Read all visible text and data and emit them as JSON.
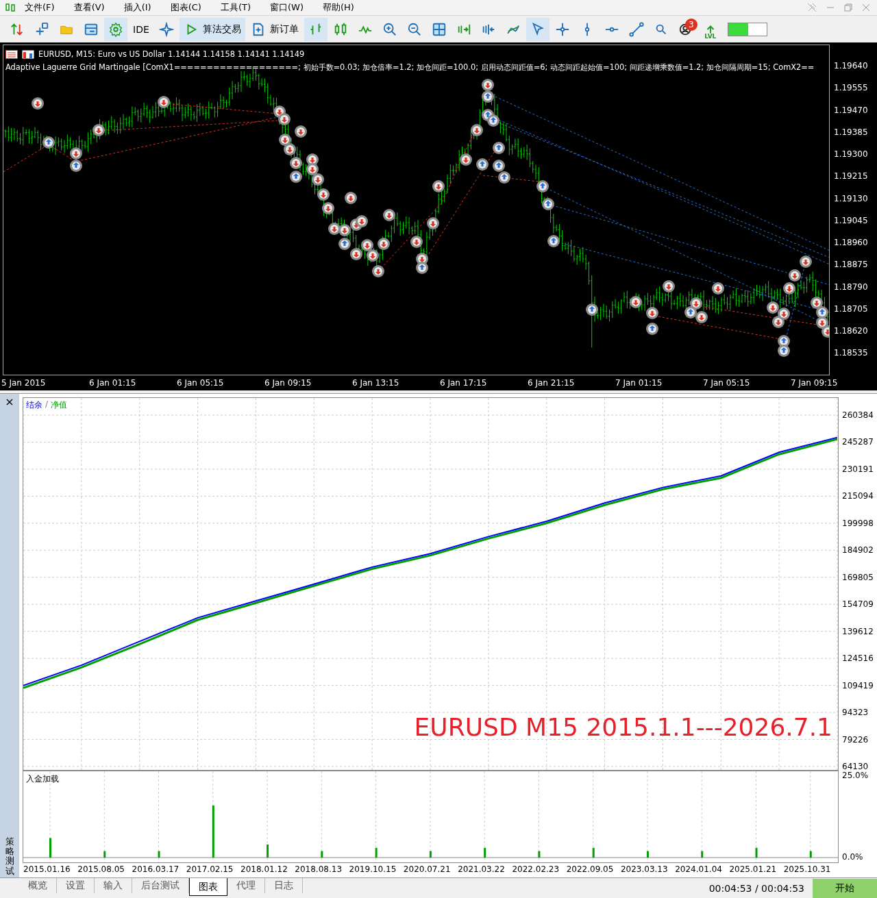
{
  "menu": {
    "items": [
      "文件(F)",
      "查看(V)",
      "插入(I)",
      "图表(C)",
      "工具(T)",
      "窗口(W)",
      "帮助(H)"
    ]
  },
  "toolbar": {
    "tools": [
      {
        "kind": "updown",
        "selected": false
      },
      {
        "kind": "crossinfo",
        "selected": false
      },
      {
        "kind": "folder",
        "selected": false
      },
      {
        "kind": "window",
        "selected": false
      },
      {
        "kind": "gear",
        "selected": true
      },
      {
        "kind": "ide",
        "label": "IDE",
        "selected": false
      },
      {
        "kind": "sparkle",
        "selected": false
      },
      {
        "kind": "play",
        "label": "算法交易",
        "selected": true
      },
      {
        "kind": "order",
        "label": "新订单",
        "selected": false
      },
      {
        "kind": "bars",
        "selected": true
      },
      {
        "kind": "candles",
        "selected": false
      },
      {
        "kind": "line",
        "selected": false
      },
      {
        "kind": "zoomin",
        "selected": false
      },
      {
        "kind": "zoomout",
        "selected": false
      },
      {
        "kind": "grid",
        "selected": false
      },
      {
        "kind": "shiftright",
        "selected": false
      },
      {
        "kind": "shiftleft",
        "selected": false
      },
      {
        "kind": "indicator",
        "selected": false
      },
      {
        "kind": "cursor",
        "selected": true
      },
      {
        "kind": "crosshair",
        "selected": false
      },
      {
        "kind": "vline",
        "selected": false
      },
      {
        "kind": "hline",
        "selected": false
      },
      {
        "kind": "trend",
        "selected": false
      },
      {
        "kind": "search",
        "selected": false
      },
      {
        "kind": "account",
        "badge": "3",
        "selected": false
      },
      {
        "kind": "lvl",
        "label": "LVL",
        "selected": false
      }
    ],
    "meter": {
      "level": 0.52
    }
  },
  "chart": {
    "symbol_line": "EURUSD, M15:  Euro vs US Dollar  1.14144 1.14158 1.14141 1.14149",
    "indicator_line": "Adaptive Laguerre Grid Martingale [ComX1===================; 初始手数=0.03; 加仓倍率=1.2; 加仓间距=100.0; 启用动态间距值=6; 动态间距起始值=100; 间距递增乘数值=1.2; 加仓间隔周期=15; ComX2==",
    "price_labels": [
      "1.19640",
      "1.19555",
      "1.19470",
      "1.19385",
      "1.19300",
      "1.19215",
      "1.19130",
      "1.19045",
      "1.18960",
      "1.18875",
      "1.18790",
      "1.18705",
      "1.18620",
      "1.18535"
    ],
    "time_labels": [
      "5 Jan 2015",
      "6 Jan 01:15",
      "6 Jan 05:15",
      "6 Jan 09:15",
      "6 Jan 13:15",
      "6 Jan 17:15",
      "6 Jan 21:15",
      "7 Jan 01:15",
      "7 Jan 05:15",
      "7 Jan 09:15"
    ]
  },
  "tester": {
    "close": "×",
    "side_title": "策略测试",
    "legend_separator": "/",
    "overlay_text": "EURUSD M15 2015.1.1---2026.7.1",
    "balance_chart": {
      "chart_data": {
        "type": "line",
        "series": [
          {
            "name": "结余",
            "color": "#0000ff",
            "values": [
              109400,
              120700,
              134000,
              147200,
              156600,
              166000,
              175500,
              183000,
              192500,
              201100,
              211300,
              220000,
              226400,
              239600,
              247900
            ]
          },
          {
            "name": "净值",
            "color": "#00a000",
            "values": [
              108000,
              119500,
              132500,
              146000,
              155500,
              165000,
              174500,
              182000,
              191500,
              200000,
              210200,
              219000,
              225300,
              238500,
              247000
            ]
          }
        ],
        "yticks": [
          {
            "value": 260384,
            "label": "260384"
          },
          {
            "value": 245287,
            "label": "245287"
          },
          {
            "value": 230191,
            "label": "230191"
          },
          {
            "value": 215094,
            "label": "215094"
          },
          {
            "value": 199998,
            "label": "199998"
          },
          {
            "value": 184902,
            "label": "184902"
          },
          {
            "value": 169805,
            "label": "169805"
          },
          {
            "value": 154709,
            "label": "154709"
          },
          {
            "value": 139612,
            "label": "139612"
          },
          {
            "value": 124516,
            "label": "124516"
          },
          {
            "value": 109419,
            "label": "109419"
          },
          {
            "value": 94323,
            "label": "94323"
          },
          {
            "value": 79226,
            "label": "79226"
          },
          {
            "value": 64130,
            "label": "64130"
          }
        ],
        "ylim": [
          62217,
          269948
        ],
        "grid": true
      }
    },
    "load_chart": {
      "chart_data": {
        "type": "bar",
        "categories": [
          "2015.01.16",
          "2015.08.05",
          "2016.03.17",
          "2017.02.15",
          "2018.01.12",
          "2018.08.13",
          "2019.10.15",
          "2020.07.21",
          "2021.03.22",
          "2022.02.23",
          "2022.09.05",
          "2023.03.13",
          "2024.01.04",
          "2025.01.21",
          "2025.10.31"
        ],
        "series": [
          {
            "name": "入金加载",
            "color": "#00a000",
            "values": [
              6,
              2,
              2,
              16,
              4,
              2,
              3,
              2,
              3,
              2,
              3,
              2,
              2,
              3,
              2
            ]
          }
        ],
        "ylim": [
          -1.47,
          26.47
        ],
        "grid": true,
        "yticks": [
          {
            "value": 25,
            "label": "25.0%"
          },
          {
            "value": 0,
            "label": "0.0%"
          }
        ]
      }
    },
    "tabs": [
      {
        "label": "概览",
        "selected": false
      },
      {
        "label": "设置",
        "selected": false
      },
      {
        "label": "输入",
        "selected": false
      },
      {
        "label": "后台测试",
        "selected": false
      },
      {
        "label": "图表",
        "selected": true
      },
      {
        "label": "代理",
        "selected": false
      },
      {
        "label": "日志",
        "selected": false
      }
    ],
    "elapsed": "00:04:53 / 00:04:53",
    "start_button": "开始"
  }
}
